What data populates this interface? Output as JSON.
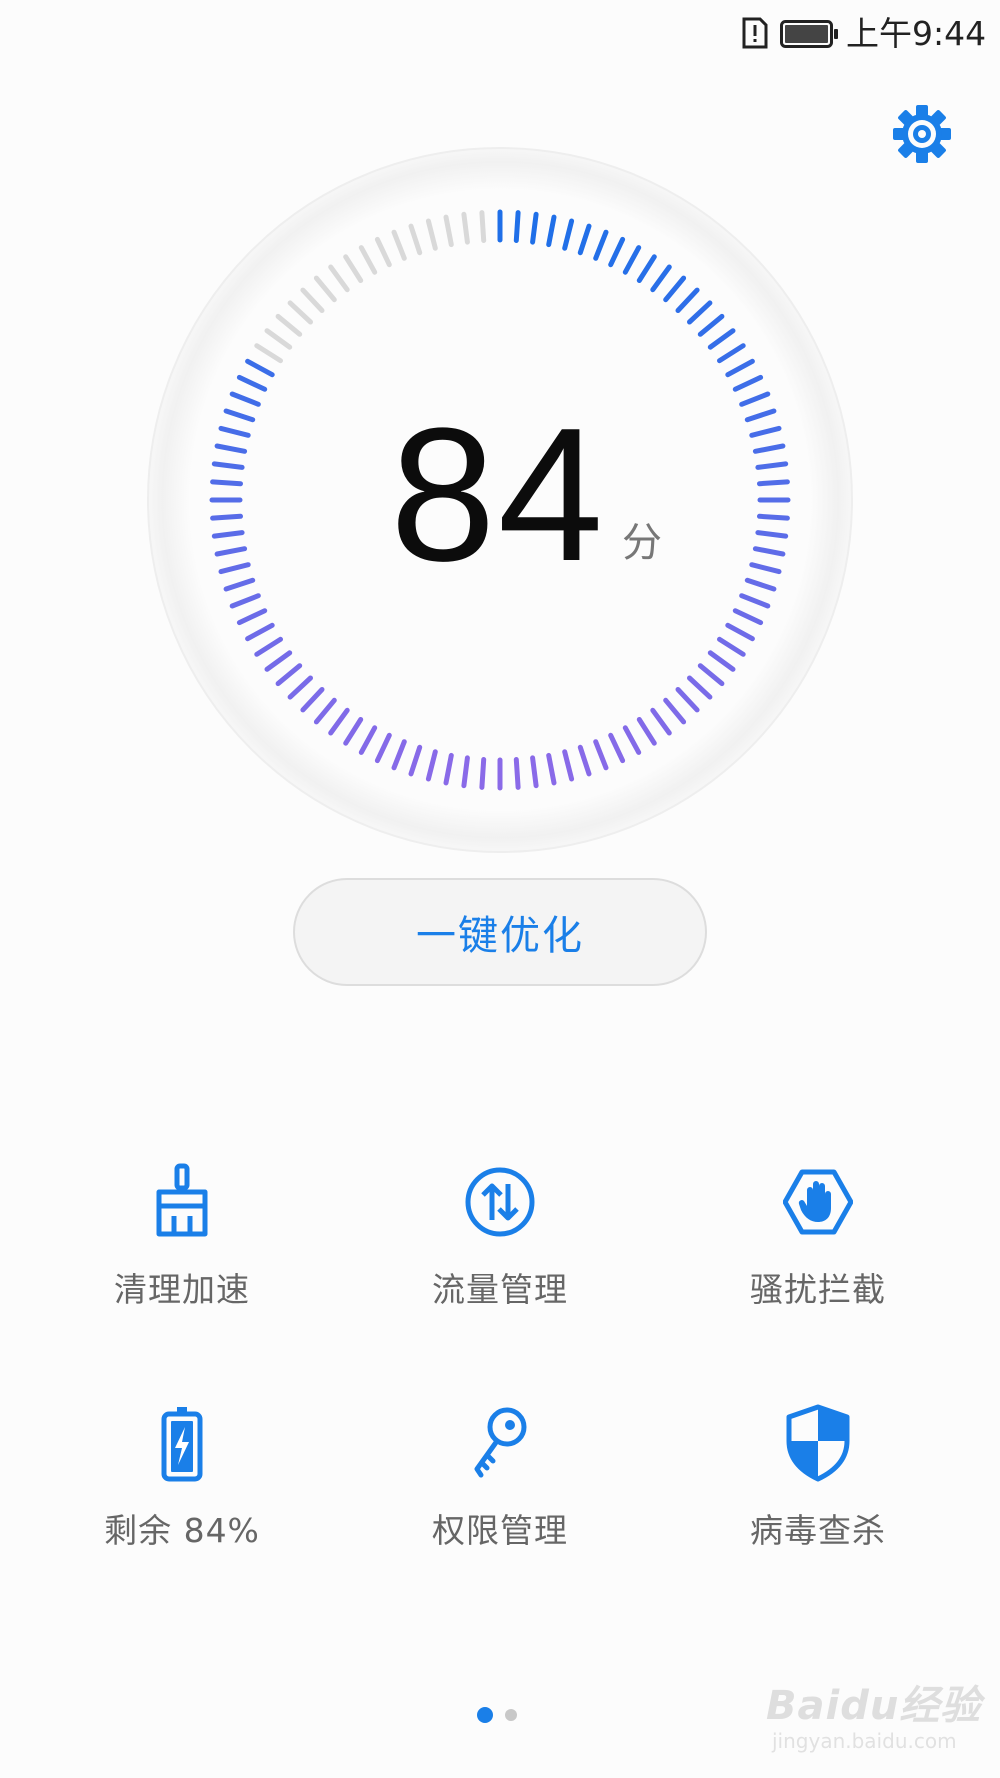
{
  "status_bar": {
    "time": "上午9:44",
    "icons": [
      "sim-alert-icon",
      "battery-icon"
    ]
  },
  "header": {
    "settings_icon": "gear-icon"
  },
  "score": {
    "value": "84",
    "unit": "分",
    "progress_fraction": 0.84
  },
  "optimize_button": {
    "label": "一键优化"
  },
  "tools": [
    {
      "label": "清理加速",
      "icon": "broom-icon"
    },
    {
      "label": "流量管理",
      "icon": "data-transfer-icon"
    },
    {
      "label": "骚扰拦截",
      "icon": "hand-block-icon"
    },
    {
      "label": "剩余 84%",
      "icon": "battery-charging-icon"
    },
    {
      "label": "权限管理",
      "icon": "key-icon"
    },
    {
      "label": "病毒查杀",
      "icon": "shield-icon"
    }
  ],
  "pager": {
    "count": 2,
    "active": 0
  },
  "watermark": {
    "line1": "Baidu经验",
    "line2": "jingyan.baidu.com"
  },
  "colors": {
    "accent": "#1a7fe8",
    "gauge_start": "#1f6fe8",
    "gauge_end": "#8a6ae8",
    "gauge_inactive": "#d9d9d9"
  }
}
